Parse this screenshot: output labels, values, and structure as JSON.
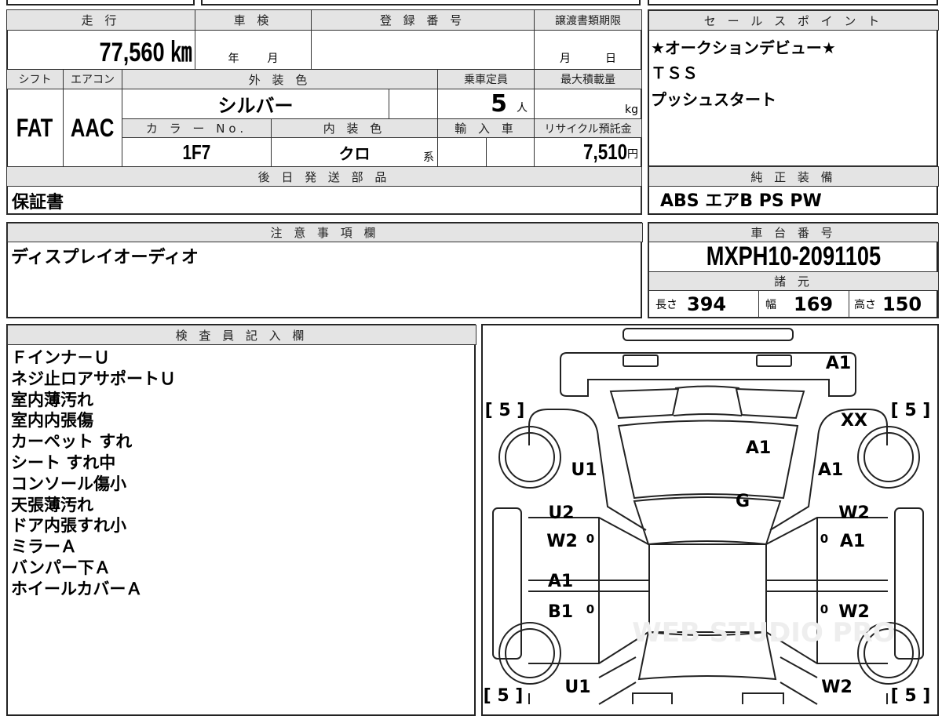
{
  "vehicle": {
    "headers": {
      "mileage": "走 行",
      "inspection": "車 検",
      "registration": "登 録 番 号",
      "transfer_deadline": "譲渡書類期限",
      "shift": "シフト",
      "aircon": "エアコン",
      "exterior_color": "外 装 色",
      "capacity": "乗車定員",
      "max_load": "最大積載量",
      "color_no": "カ ラ ー No.",
      "interior_color": "内 装 色",
      "import": "輸 入 車",
      "recycle_fee": "リサイクル預託金",
      "later_parts": "後 日 発 送 部 品"
    },
    "mileage": "77,560 ㎞",
    "inspection_year_unit": "年",
    "inspection_month_unit": "月",
    "registration_number": "",
    "transfer_month_unit": "月",
    "transfer_day_unit": "日",
    "shift": "FAT",
    "aircon": "AAC",
    "exterior_color": "シルバー",
    "capacity": "5",
    "capacity_unit": "人",
    "max_load_unit": "kg",
    "color_no": "1F7",
    "interior_color": "クロ",
    "interior_color_suffix": "系",
    "recycle_fee": "7,510",
    "recycle_fee_unit": "円",
    "later_parts": "保証書"
  },
  "sales_points": {
    "header": "セ ー ル ス ポ イ ン ト",
    "items": [
      "★オークションデビュー★",
      "ＴＳＳ",
      "プッシュスタート"
    ]
  },
  "equipment": {
    "header": "純 正 装 備",
    "value": "ABS エアB PS PW"
  },
  "notes": {
    "header": "注 意 事 項 欄",
    "value": "ディスプレイオーディオ"
  },
  "chassis": {
    "header": "車 台 番 号",
    "value": "MXPH10-2091105",
    "specs_header": "諸 元",
    "length_label": "長さ",
    "length": "394",
    "width_label": "幅",
    "width": "169",
    "height_label": "高さ",
    "height": "150"
  },
  "inspector": {
    "header": "検 査 員 記 入 欄",
    "items": [
      "Ｆインナ－Ｕ",
      "ネジ止ロアサポートＵ",
      "室内薄汚れ",
      "室内内張傷",
      "カーペット すれ",
      "シート すれ中",
      "コンソール傷小",
      "天張薄汚れ",
      "ドア内張すれ小",
      "ミラーＡ",
      "バンパー下Ａ",
      "ホイールカバーＡ"
    ]
  },
  "diagram": {
    "tire_front_left": "[ 5 ]",
    "tire_front_right": "[ 5 ]",
    "tire_rear_left": "[ 5 ]",
    "tire_rear_right": "[ 5 ]",
    "front_bumper": "A1",
    "front_right_fender_top": "XX",
    "hood": "A1",
    "left_front_fender": "U1",
    "right_front_fender": "A1",
    "windshield": "G",
    "left_front_door_1": "U2",
    "left_front_door_2": "W2",
    "right_front_door_1": "W2",
    "right_front_door_2": "A1",
    "left_rear_door_1": "A1",
    "left_rear_door_2": "B1",
    "right_rear_door": "W2",
    "left_rear_quarter": "U1",
    "right_rear_quarter": "W2",
    "door_marker": "0",
    "watermark": "WEB STUDIO PRO"
  }
}
